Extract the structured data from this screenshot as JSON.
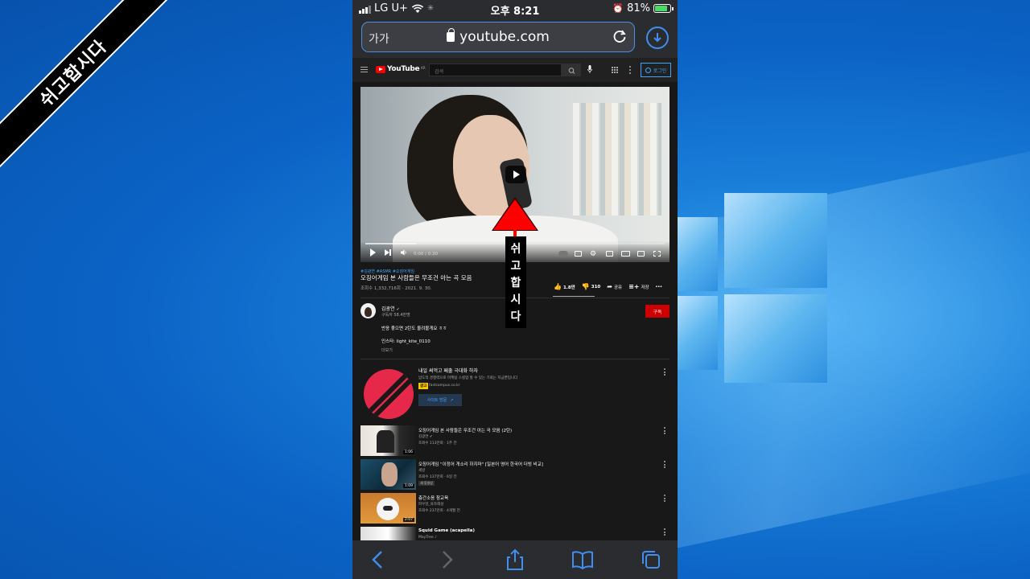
{
  "overlay": {
    "ribbon_text": "쉬고합시다",
    "vertical_label_chars": [
      "쉬",
      "고",
      "합",
      "시",
      "다"
    ]
  },
  "statusbar": {
    "carrier": "LG U+",
    "time": "오후 8:21",
    "battery": "81%",
    "battery_level": 0.81
  },
  "browser": {
    "text_size_button": "가가",
    "url": "youtube.com"
  },
  "youtube": {
    "logo_text": "YouTube",
    "logo_region": "KR",
    "search_placeholder": "검색",
    "login_label": "로그인",
    "player": {
      "time": "0:00 / 0:30",
      "progress": 0.0,
      "buffered": 0.17
    },
    "video": {
      "tags": "#김광연 #ASMR #오징어게임",
      "title": "오징어게임 본 사람들은 무조건 아는 곡 모음",
      "meta": "조회수 1,332,716회 · 2021. 9. 30.",
      "likes": "1.8만",
      "dislikes": "310",
      "share": "공유",
      "save": "저장"
    },
    "channel": {
      "name": "김광연",
      "subscribers": "구독자 58.4만명",
      "subscribe_label": "구독",
      "description_lines": [
        "반응 좋으면 2탄도 올려볼게요 ㅎㅎ",
        "인스타: light_kite_0110"
      ],
      "more_label": "더보기"
    },
    "ad": {
      "title": "내일 써먹고 페출 극대화 하자",
      "subtitle": "압도적 경쟁력으로 마케팅 스킬업 할 수 있는 기회는 지금뿐입니다",
      "badge": "광고",
      "domain": "fastcampus.co.kr",
      "button": "사이트 방문"
    },
    "related": [
      {
        "title": "오징어게임 본 사람들은 무조건 아는 곡 모음 (2탄)",
        "channel": "김광연",
        "meta": "조회수 113만회 · 1주 전",
        "duration": "1:06",
        "badge": ""
      },
      {
        "title": "오징어게임 \"이정어 개소리 하지마\" [일본어 영어 한국어 더빙 비교]",
        "channel": "세방",
        "meta": "조회수 137만회 · 6일 전",
        "duration": "1:09",
        "badge": "새 동영상"
      },
      {
        "title": "층간소음 참교육",
        "channel": "파우엉_육하해설",
        "meta": "조회수 237만회 · 4개월 전",
        "duration": "2:07",
        "badge": ""
      },
      {
        "title": "Squid Game (acapella)",
        "channel": "MayTree ♪",
        "meta": "",
        "duration": "",
        "badge": ""
      }
    ]
  },
  "colors": {
    "desktop_blue": "#0b63c5",
    "yt_red": "#ff0000",
    "safari_blue": "#3f8ef0",
    "subscribe_red": "#cc0000"
  }
}
